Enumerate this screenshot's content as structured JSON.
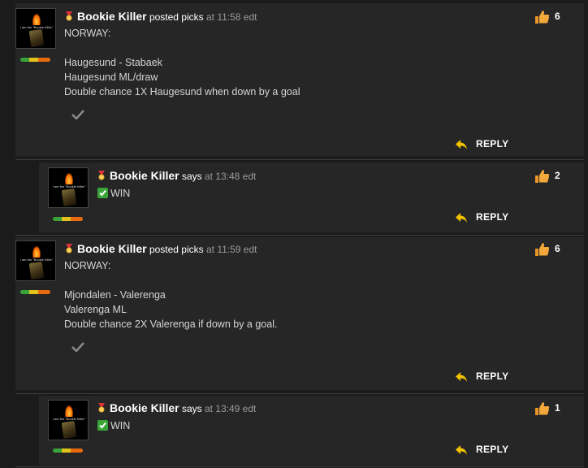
{
  "posts": [
    {
      "user": "Bookie Killer",
      "verb": "posted picks",
      "time": "at 11:58 edt",
      "lines": [
        "NORWAY:",
        "",
        "Haugesund - Stabaek",
        "Haugesund ML/draw",
        "Double chance 1X Haugesund when down by a goal"
      ],
      "likes": "6",
      "reply": "REPLY",
      "avatar_text": "I am the \"Bookie Killer\""
    },
    {
      "user": "Bookie Killer",
      "verb": "says",
      "time": "at 13:48 edt",
      "result": "WIN",
      "likes": "2",
      "reply": "REPLY",
      "avatar_text": "I am the \"Bookie Killer\""
    },
    {
      "user": "Bookie Killer",
      "verb": "posted picks",
      "time": "at 11:59 edt",
      "lines": [
        "NORWAY:",
        "",
        "Mjondalen - Valerenga",
        "Valerenga ML",
        "Double chance 2X Valerenga if down by a goal."
      ],
      "likes": "6",
      "reply": "REPLY",
      "avatar_text": "I am the \"Bookie Killer\""
    },
    {
      "user": "Bookie Killer",
      "verb": "says",
      "time": "at 13:49 edt",
      "result": "WIN",
      "likes": "1",
      "reply": "REPLY",
      "avatar_text": "I am the \"Bookie Killer\""
    }
  ],
  "icons": {
    "medal": "medal-icon",
    "thumb": "thumbs-up-icon",
    "reply": "reply-arrow-icon",
    "check": "checkmark-icon",
    "win": "green-check-box-icon"
  },
  "colors": {
    "background": "#1b1b1b",
    "post_bg": "#262626",
    "like_accent": "#f0a530",
    "reply_arrow": "#f2c200",
    "win_green": "#3aa63a"
  }
}
